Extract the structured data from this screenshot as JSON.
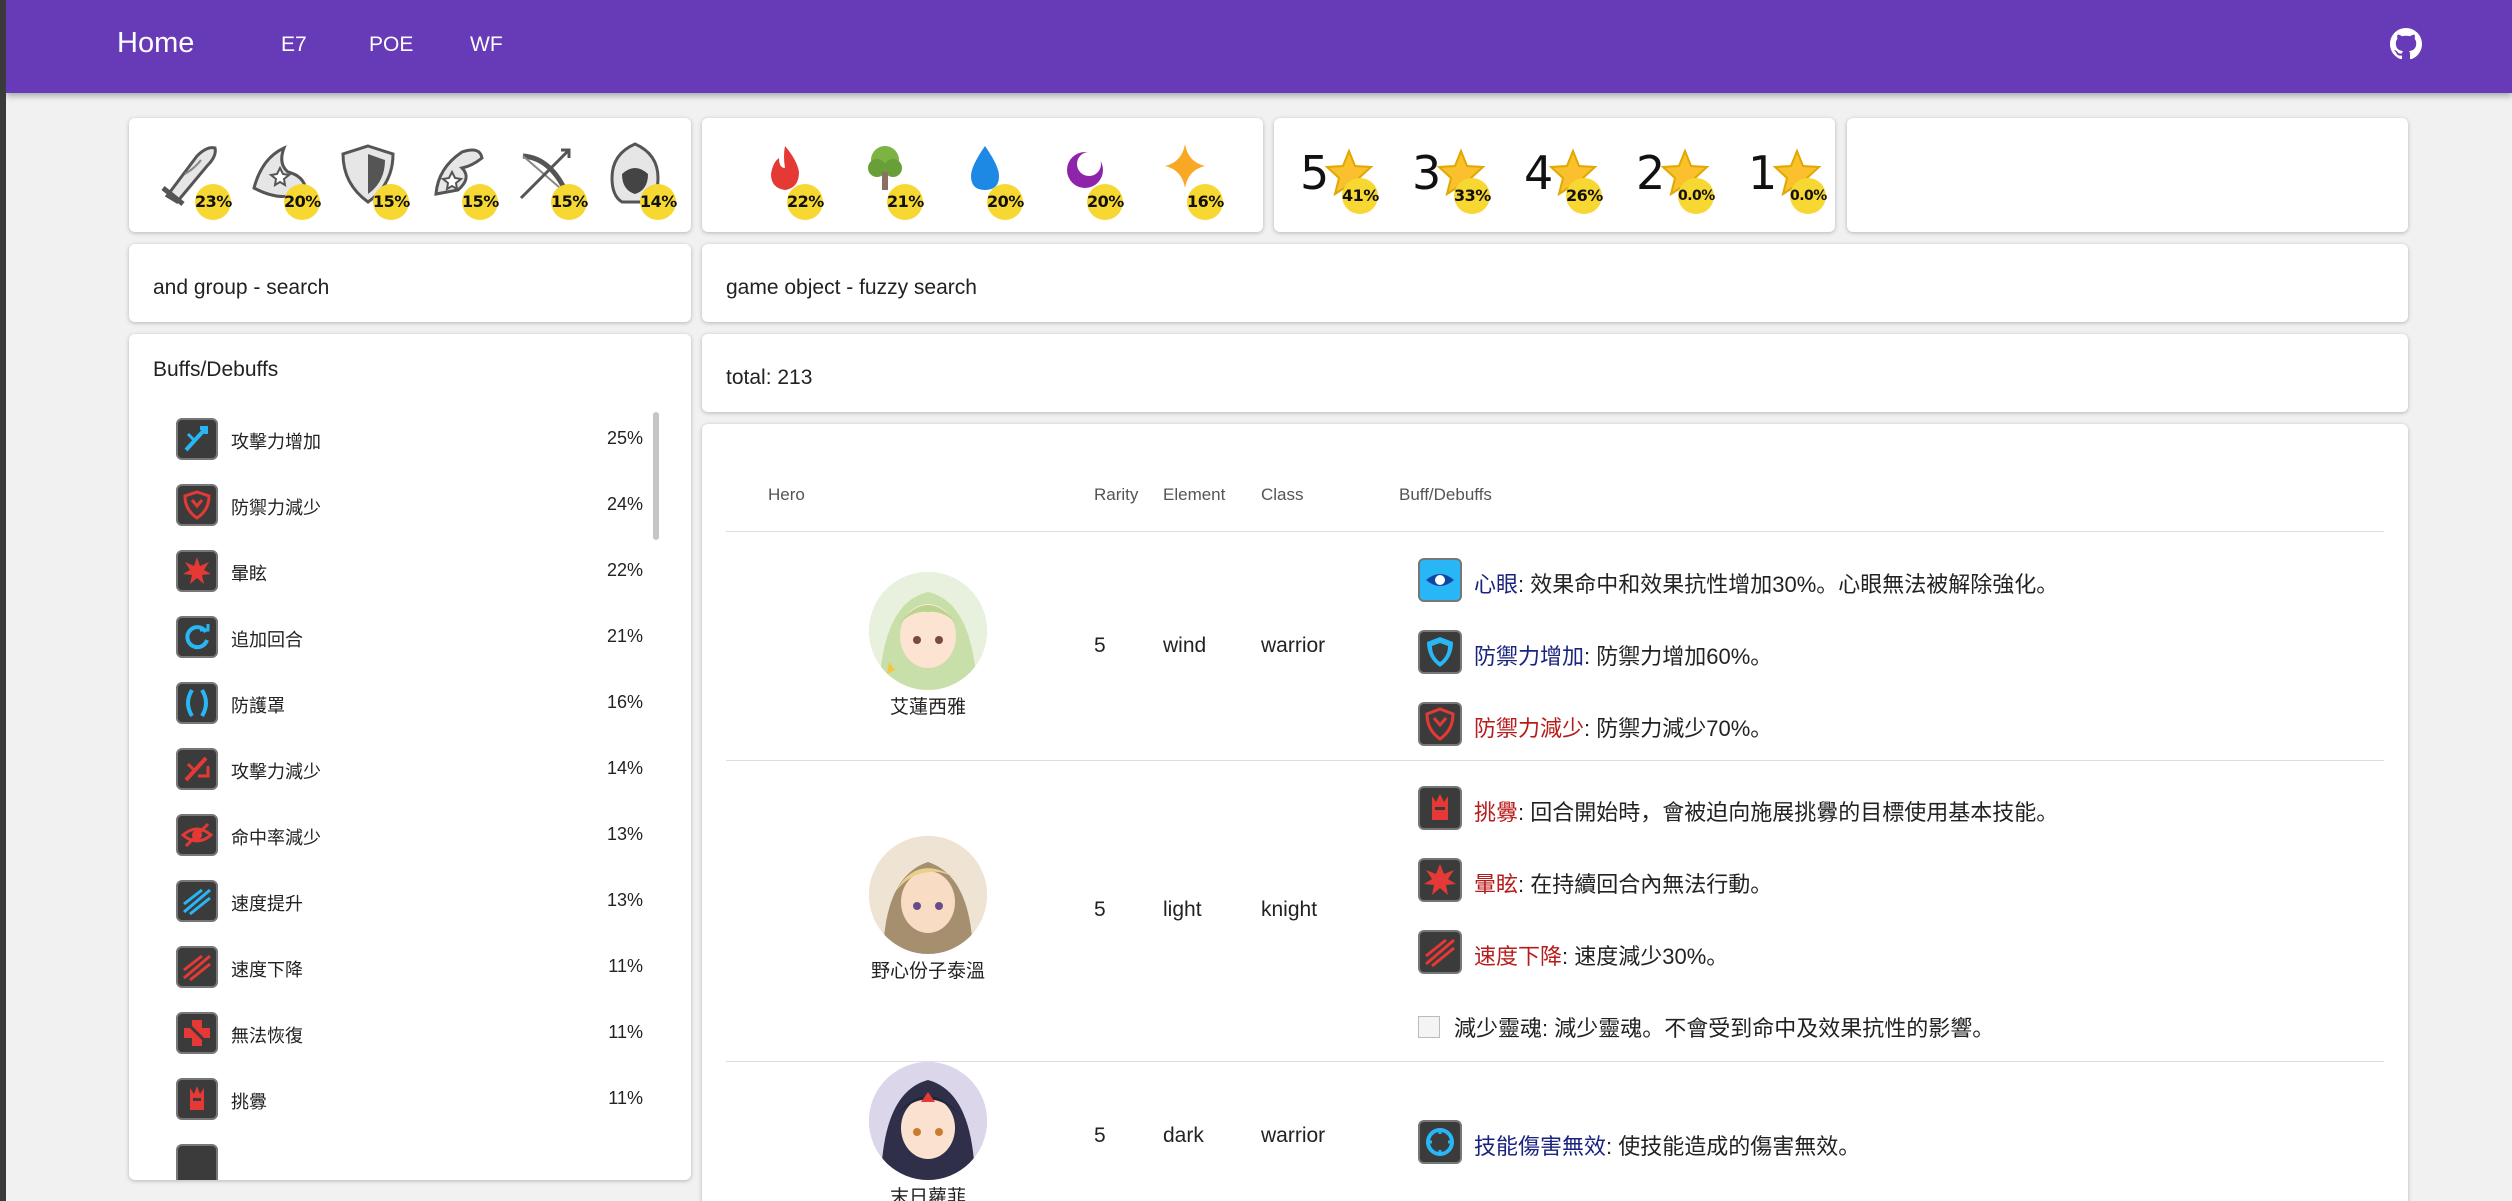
{
  "nav": {
    "home": "Home",
    "links": [
      "E7",
      "POE",
      "WF"
    ]
  },
  "classes": [
    {
      "icon": "knight-class-icon",
      "pct": "23%"
    },
    {
      "icon": "mage-class-icon",
      "pct": "20%"
    },
    {
      "icon": "warrior-shield-class-icon",
      "pct": "15%"
    },
    {
      "icon": "soul-weaver-class-icon",
      "pct": "15%"
    },
    {
      "icon": "ranger-class-icon",
      "pct": "15%"
    },
    {
      "icon": "thief-class-icon",
      "pct": "14%"
    }
  ],
  "elements": [
    {
      "icon": "fire-element-icon",
      "pct": "22%",
      "color": "#e53935"
    },
    {
      "icon": "earth-element-icon",
      "pct": "21%",
      "color": "#7cb342"
    },
    {
      "icon": "ice-element-icon",
      "pct": "20%",
      "color": "#1e88e5"
    },
    {
      "icon": "dark-element-icon",
      "pct": "20%",
      "color": "#8e24aa"
    },
    {
      "icon": "light-element-icon",
      "pct": "16%",
      "color": "#f9a825"
    }
  ],
  "rarities": [
    {
      "num": "5",
      "pct": "41%"
    },
    {
      "num": "3",
      "pct": "33%"
    },
    {
      "num": "4",
      "pct": "26%"
    },
    {
      "num": "2",
      "pct": "0.0%"
    },
    {
      "num": "1",
      "pct": "0.0%"
    }
  ],
  "search": {
    "group": "and group - search",
    "fuzzy": "game object - fuzzy search"
  },
  "buffs_panel": {
    "title": "Buffs/Debuffs",
    "items": [
      {
        "label": "攻擊力增加",
        "pct": "25%",
        "icon": "attack-up-icon",
        "color": "#29b6f6"
      },
      {
        "label": "防禦力減少",
        "pct": "24%",
        "icon": "defense-down-icon",
        "color": "#e53935"
      },
      {
        "label": "暈眩",
        "pct": "22%",
        "icon": "stun-icon",
        "color": "#e53935"
      },
      {
        "label": "追加回合",
        "pct": "21%",
        "icon": "extra-turn-icon",
        "color": "#29b6f6"
      },
      {
        "label": "防護罩",
        "pct": "16%",
        "icon": "barrier-icon",
        "color": "#29b6f6"
      },
      {
        "label": "攻擊力減少",
        "pct": "14%",
        "icon": "attack-down-icon",
        "color": "#e53935"
      },
      {
        "label": "命中率減少",
        "pct": "13%",
        "icon": "hit-down-icon",
        "color": "#e53935"
      },
      {
        "label": "速度提升",
        "pct": "13%",
        "icon": "speed-up-icon",
        "color": "#29b6f6"
      },
      {
        "label": "速度下降",
        "pct": "11%",
        "icon": "speed-down-icon",
        "color": "#e53935"
      },
      {
        "label": "無法恢復",
        "pct": "11%",
        "icon": "unhealable-icon",
        "color": "#e53935"
      },
      {
        "label": "挑釁",
        "pct": "11%",
        "icon": "provoke-icon",
        "color": "#e53935"
      }
    ]
  },
  "total": "total: 213",
  "table": {
    "headers": {
      "hero": "Hero",
      "rarity": "Rarity",
      "element": "Element",
      "class": "Class",
      "buffs": "Buff/Debuffs"
    },
    "rows": [
      {
        "name": "艾蓮西雅",
        "rarity": "5",
        "element": "wind",
        "class": "warrior",
        "buffs": [
          {
            "name": "心眼",
            "desc": ": 效果命中和效果抗性增加30%。心眼無法被解除強化。",
            "type": "buff",
            "icon": "vigilance-icon",
            "color": "#29b6f6"
          },
          {
            "name": "防禦力增加",
            "desc": ": 防禦力增加60%。",
            "type": "buff",
            "icon": "defense-up-icon",
            "color": "#29b6f6"
          },
          {
            "name": "防禦力減少",
            "desc": ": 防禦力減少70%。",
            "type": "debuff",
            "icon": "defense-down-icon",
            "color": "#e53935"
          }
        ]
      },
      {
        "name": "野心份子泰溫",
        "rarity": "5",
        "element": "light",
        "class": "knight",
        "buffs": [
          {
            "name": "挑釁",
            "desc": ": 回合開始時，會被迫向施展挑釁的目標使用基本技能。",
            "type": "debuff",
            "icon": "provoke-icon",
            "color": "#e53935"
          },
          {
            "name": "暈眩",
            "desc": ": 在持續回合內無法行動。",
            "type": "debuff",
            "icon": "stun-icon",
            "color": "#e53935"
          },
          {
            "name": "速度下降",
            "desc": ": 速度減少30%。",
            "type": "debuff",
            "icon": "speed-down-icon",
            "color": "#e53935"
          },
          {
            "name": "",
            "desc": "減少靈魂: 減少靈魂。不會受到命中及效果抗性的影響。",
            "type": "plain",
            "icon": "broken-image-icon",
            "color": "#bbbbbb"
          }
        ]
      },
      {
        "name": "末日蘿菲",
        "rarity": "5",
        "element": "dark",
        "class": "warrior",
        "buffs": [
          {
            "name": "技能傷害無效",
            "desc": ": 使技能造成的傷害無效。",
            "type": "buff",
            "icon": "skill-nullify-icon",
            "color": "#29b6f6"
          }
        ]
      }
    ]
  }
}
